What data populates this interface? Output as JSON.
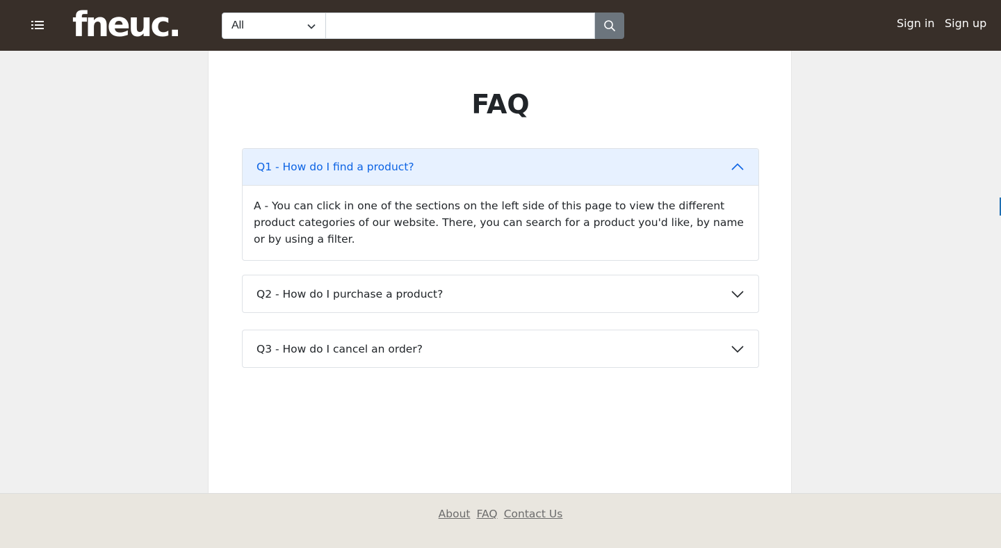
{
  "header": {
    "logo_text": "fneuc.",
    "search_category": "All",
    "search_placeholder": "",
    "sign_in": "Sign in",
    "sign_up": "Sign up"
  },
  "main": {
    "title": "FAQ",
    "faq": [
      {
        "question": "Q1 - How do I find a product?",
        "answer": "A - You can click in one of the sections on the left side of this page to view the different product categories of our website. There, you can search for a product you'd like, by name or by using a filter.",
        "expanded": true
      },
      {
        "question": "Q2 - How do I purchase a product?",
        "expanded": false
      },
      {
        "question": "Q3 - How do I cancel an order?",
        "expanded": false
      }
    ]
  },
  "footer": {
    "links": [
      "About",
      "FAQ",
      "Contact Us"
    ]
  },
  "icons": {
    "menu": "list-icon",
    "search": "search-icon",
    "dropdown": "chevron-down-icon",
    "collapse": "chevron-up-icon"
  },
  "colors": {
    "navbar": "#382f29",
    "accent": "#0c63e4",
    "accordion_active_bg": "#e7f1ff",
    "footer_bg": "#e9e6df"
  }
}
